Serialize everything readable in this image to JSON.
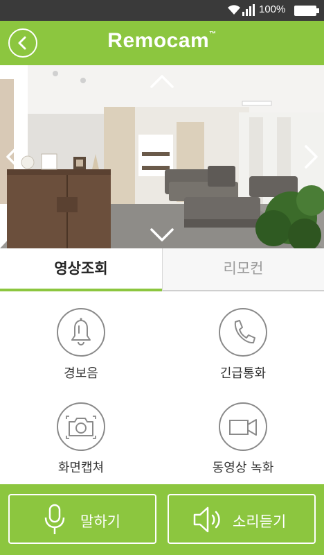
{
  "status_bar": {
    "battery_text": "100%",
    "icons": [
      "wifi-icon",
      "signal-icon",
      "battery-icon"
    ]
  },
  "header": {
    "title": "Remocam",
    "trademark": "™",
    "back_icon": "chevron-left-icon"
  },
  "camera": {
    "controls": [
      "pan-up",
      "pan-down",
      "pan-left",
      "pan-right"
    ]
  },
  "tabs": [
    {
      "label": "영상조회",
      "active": true
    },
    {
      "label": "리모컨",
      "active": false
    }
  ],
  "actions": [
    {
      "label": "경보음",
      "icon": "bell-icon"
    },
    {
      "label": "긴급통화",
      "icon": "phone-icon"
    },
    {
      "label": "화면캡쳐",
      "icon": "camera-icon"
    },
    {
      "label": "동영상 녹화",
      "icon": "video-camera-icon"
    }
  ],
  "bottom": {
    "talk_label": "말하기",
    "listen_label": "소리듣기"
  },
  "colors": {
    "accent": "#8cc63f",
    "status_bar": "#3a3a3a",
    "icon_gray": "#8a8a8a"
  }
}
